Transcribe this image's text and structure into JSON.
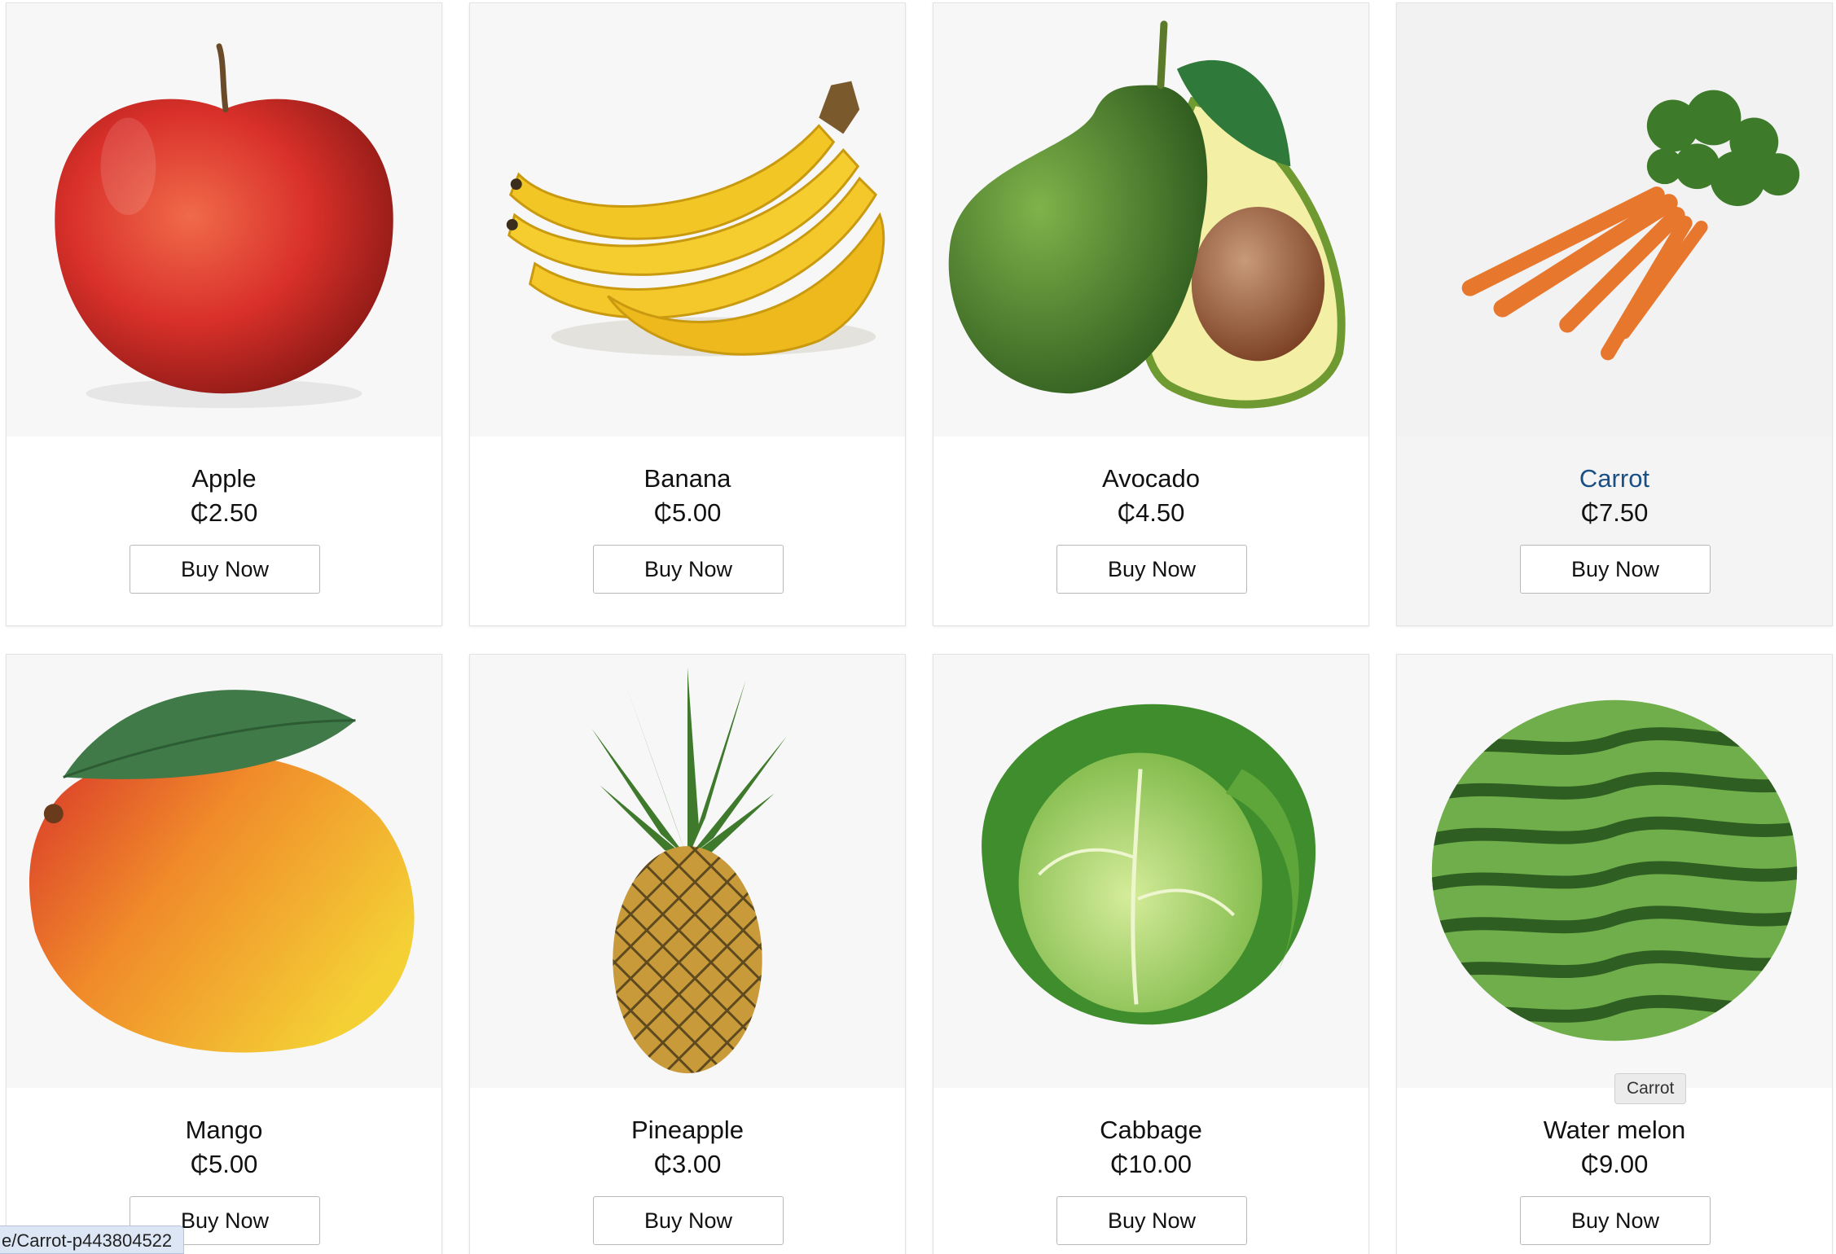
{
  "products": [
    {
      "name": "Apple",
      "price": "₵2.50",
      "button": "Buy Now",
      "image": "apple"
    },
    {
      "name": "Banana",
      "price": "₵5.00",
      "button": "Buy Now",
      "image": "banana"
    },
    {
      "name": "Avocado",
      "price": "₵4.50",
      "button": "Buy Now",
      "image": "avocado"
    },
    {
      "name": "Carrot",
      "price": "₵7.50",
      "button": "Buy Now",
      "image": "carrot"
    },
    {
      "name": "Mango",
      "price": "₵5.00",
      "button": "Buy Now",
      "image": "mango"
    },
    {
      "name": "Pineapple",
      "price": "₵3.00",
      "button": "Buy Now",
      "image": "pineapple"
    },
    {
      "name": "Cabbage",
      "price": "₵10.00",
      "button": "Buy Now",
      "image": "cabbage"
    },
    {
      "name": "Water melon",
      "price": "₵9.00",
      "button": "Buy Now",
      "image": "watermelon"
    }
  ],
  "hovered_product": "Carrot",
  "tooltip": "Carrot",
  "status_bar_url": "e/Carrot-p443804522",
  "colors": {
    "hover_title": "#1a4f86",
    "card_border": "#e3e3e3",
    "image_bg": "#f7f7f7"
  }
}
